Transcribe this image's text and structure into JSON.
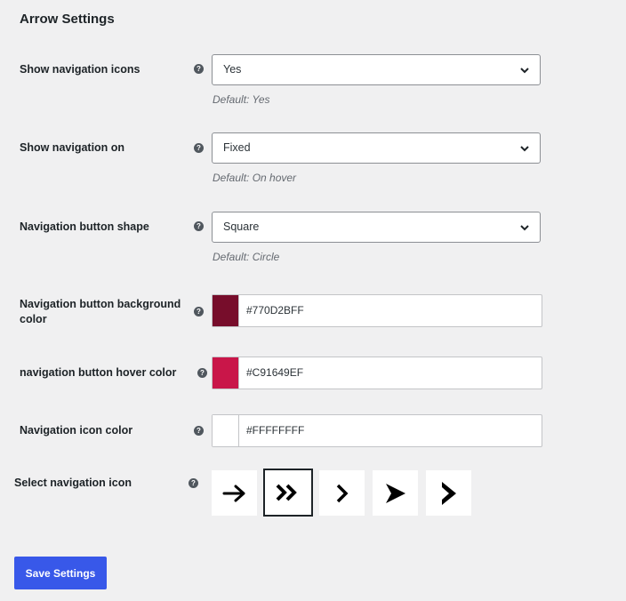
{
  "section_title": "Arrow Settings",
  "help_glyph": "?",
  "settings": {
    "show_icons": {
      "label": "Show navigation icons",
      "value": "Yes",
      "default": "Default: Yes"
    },
    "show_on": {
      "label": "Show navigation on",
      "value": "Fixed",
      "default": "Default: On hover"
    },
    "shape": {
      "label": "Navigation button shape",
      "value": "Square",
      "default": "Default: Circle"
    },
    "bg_color": {
      "label": "Navigation button background color",
      "value": "#770D2BFF",
      "swatch": "#770D2B"
    },
    "hover_color": {
      "label": "navigation button hover color",
      "value": "#C91649EF",
      "swatch": "#C91649"
    },
    "icon_color": {
      "label": "Navigation icon color",
      "value": "#FFFFFFFF",
      "swatch": "#FFFFFF"
    },
    "nav_icon": {
      "label": "Select navigation icon",
      "options": [
        "arrow-right-icon",
        "double-chevron-right-icon",
        "chevron-right-icon",
        "arrowhead-right-icon",
        "notched-arrow-right-icon"
      ],
      "selected": "double-chevron-right-icon"
    }
  },
  "save_label": "Save Settings",
  "colors": {
    "accent": "#3858e9",
    "background": "#f0f0f1"
  }
}
